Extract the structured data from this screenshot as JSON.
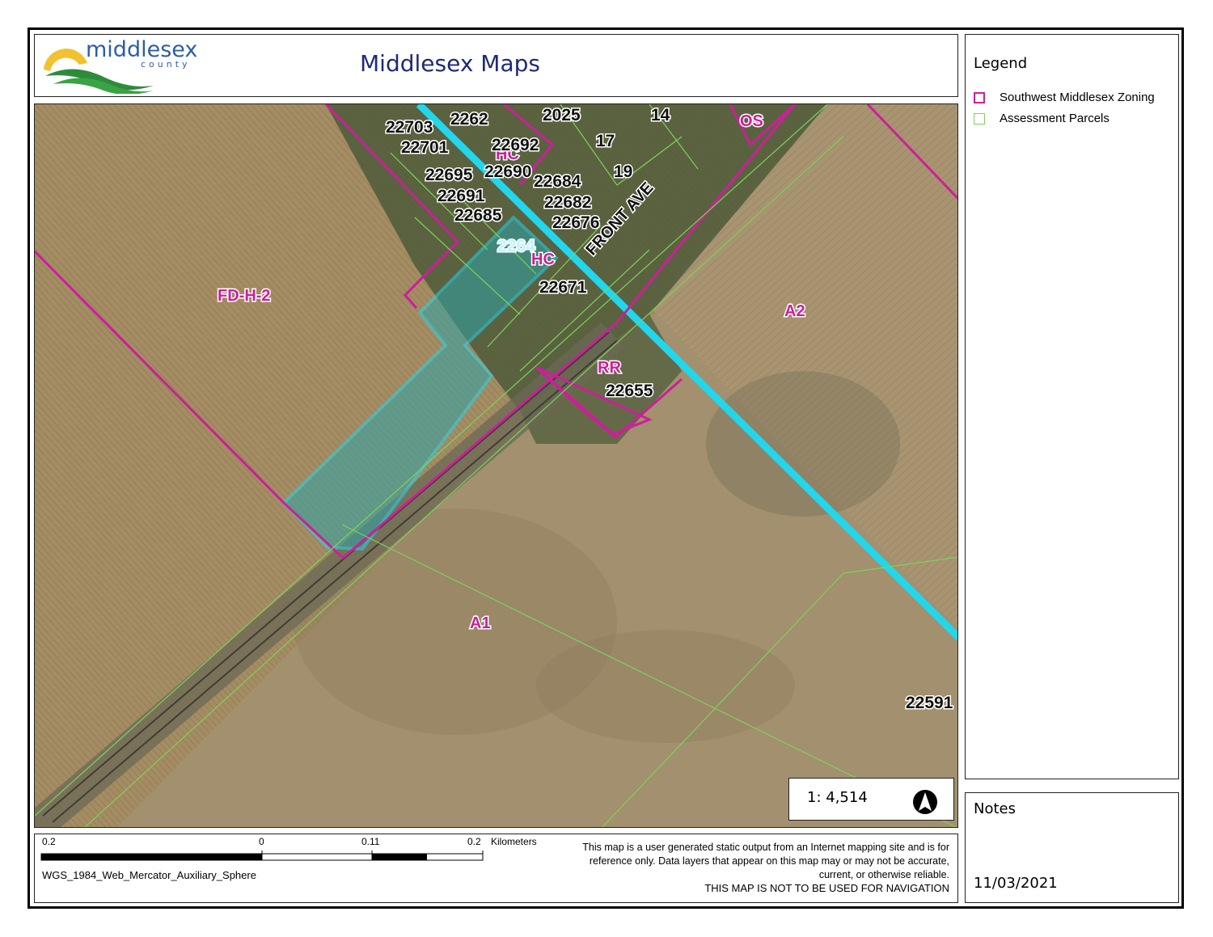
{
  "header": {
    "logo_text": "middlesex",
    "logo_sub": "county",
    "title": "Middlesex Maps"
  },
  "legend": {
    "title": "Legend",
    "items": [
      {
        "label": "Southwest Middlesex Zoning",
        "color": "#cc1f9a"
      },
      {
        "label": "Assessment Parcels",
        "color": "#7dd35a"
      }
    ]
  },
  "notes": {
    "title": "Notes",
    "date": "11/03/2021"
  },
  "map": {
    "scale": "1: 4,514",
    "zones": [
      "FD-H-2",
      "A2",
      "A1",
      "RR",
      "HC",
      "HC",
      "OS"
    ],
    "parcel_numbers": [
      "22703",
      "2262",
      "2025",
      "14",
      "22701",
      "22692",
      "17",
      "22695",
      "22690",
      "22684",
      "19",
      "22691",
      "22682",
      "22685",
      "22676",
      "22671",
      "22655",
      "22591",
      "2264"
    ],
    "streets": [
      "FRONT AVE"
    ],
    "colors": {
      "zoning": "#cc1f9a",
      "parcels": "#7dd35a",
      "highlight": "#22d6ec",
      "field": "#a8926a"
    }
  },
  "footer": {
    "scalebar_labels": [
      "0.2",
      "0",
      "0.11",
      "0.2"
    ],
    "scalebar_unit": "Kilometers",
    "projection": "WGS_1984_Web_Mercator_Auxiliary_Sphere",
    "disclaimer": "This map is a user generated static output from an Internet mapping site and is for reference only. Data layers that appear on this map may or may not be accurate, current, or otherwise reliable.",
    "nav_warning": "THIS MAP IS NOT TO BE USED FOR NAVIGATION"
  }
}
